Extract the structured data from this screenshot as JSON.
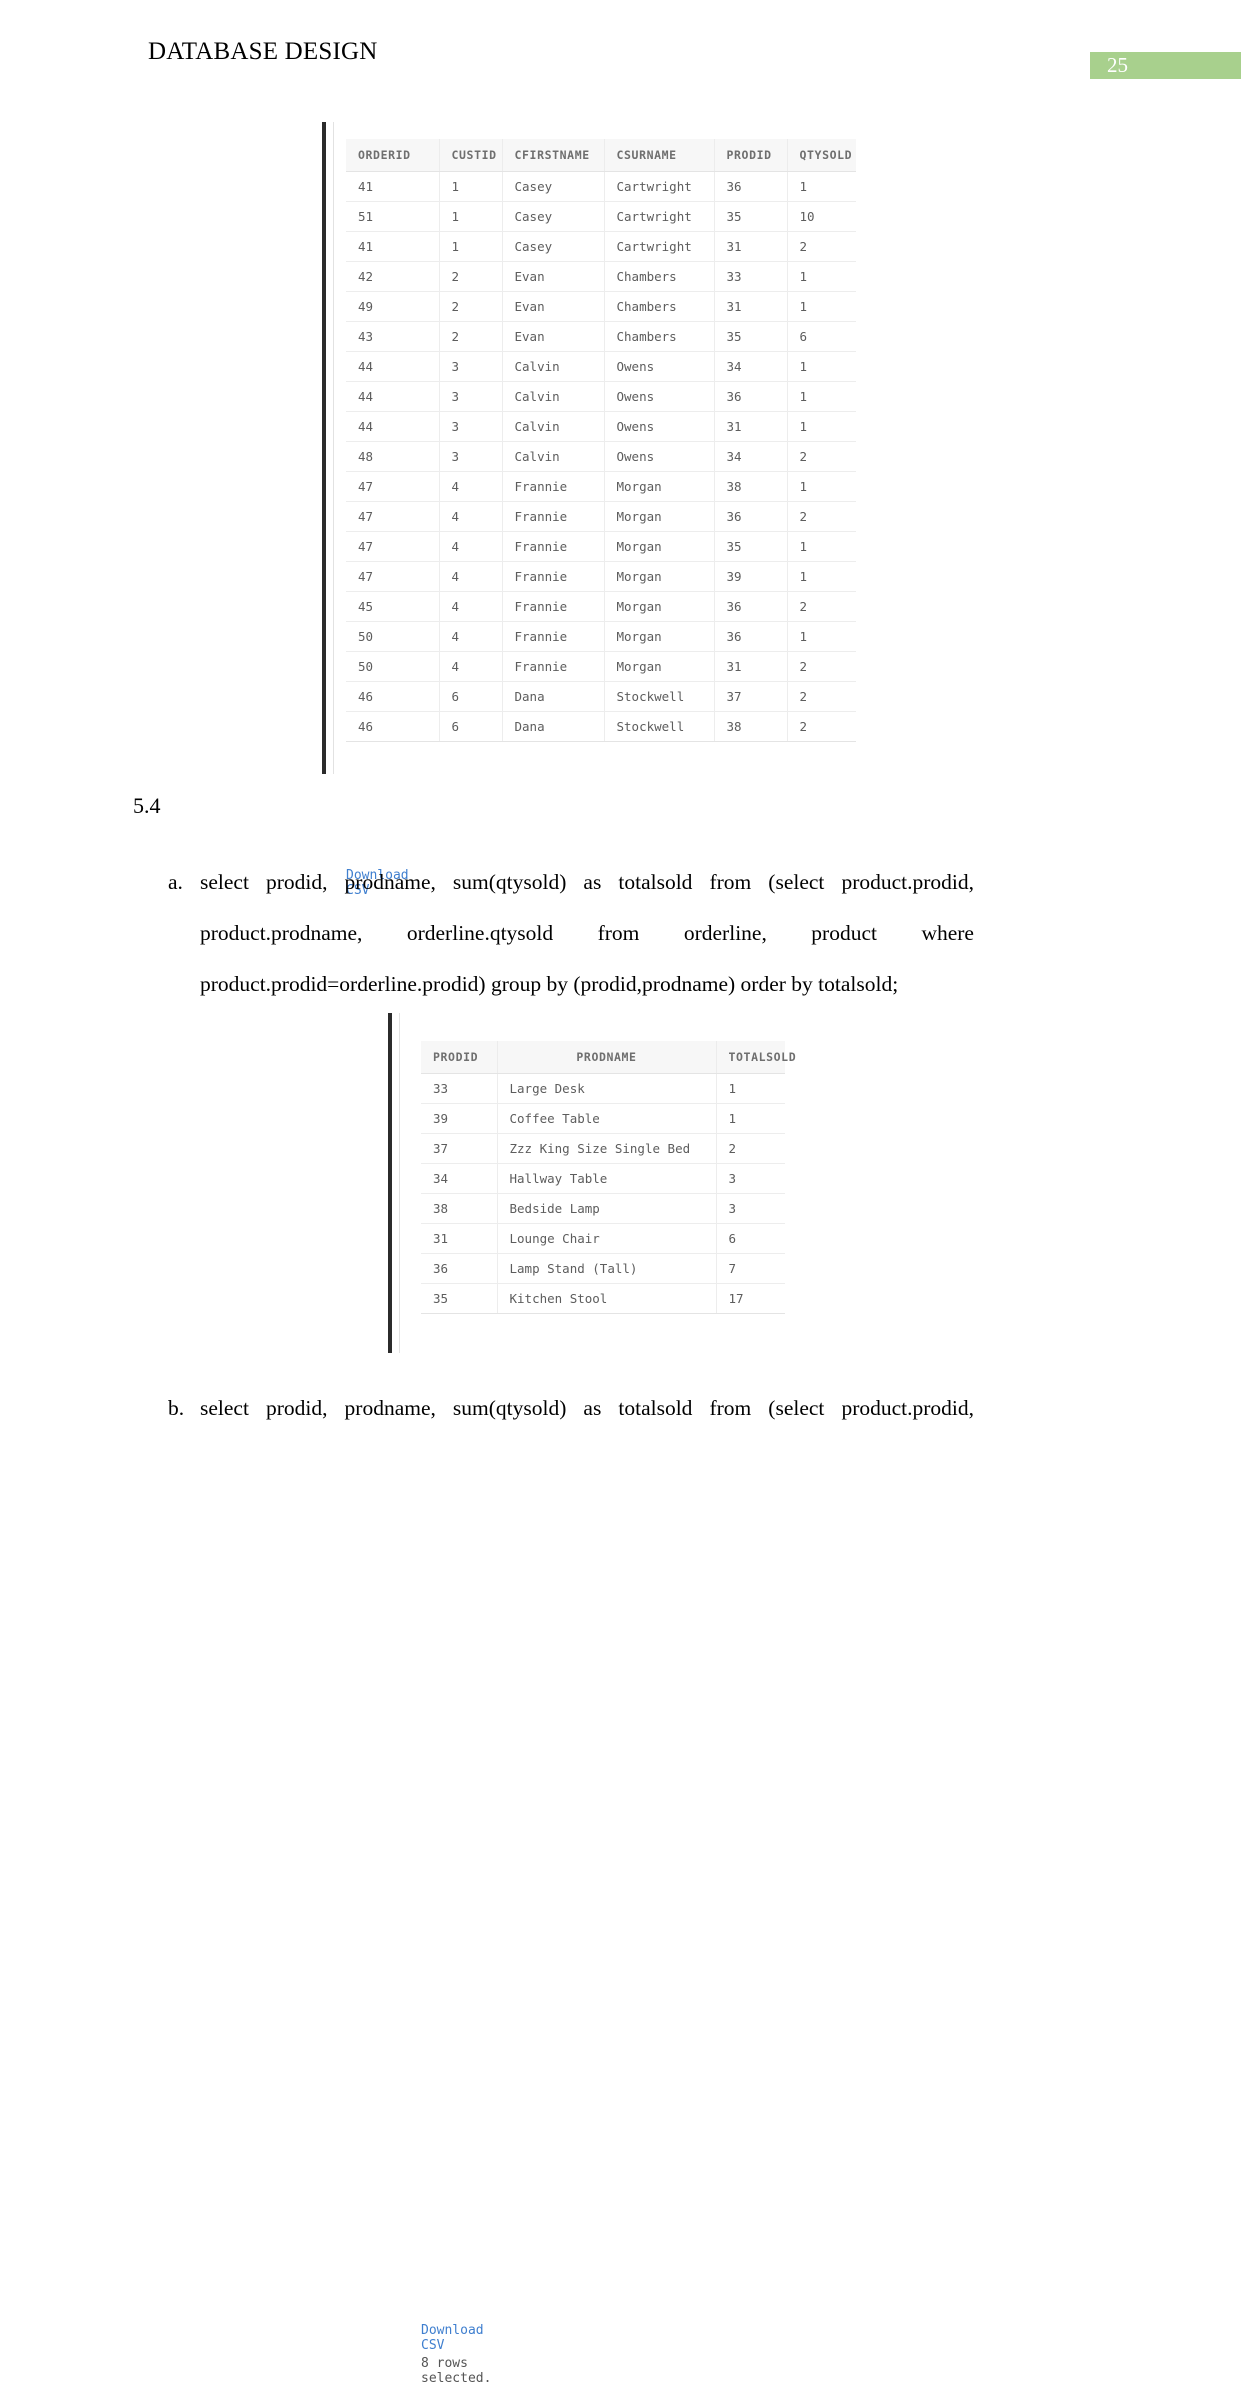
{
  "header": {
    "document_title": "DATABASE DESIGN",
    "page_number": "25",
    "badge_color": "#a8d08d"
  },
  "section": {
    "number": "5.4"
  },
  "orderline_result": {
    "columns": [
      "ORDERID",
      "CUSTID",
      "CFIRSTNAME",
      "CSURNAME",
      "PRODID",
      "QTYSOLD"
    ],
    "rows": [
      [
        "41",
        "1",
        "Casey",
        "Cartwright",
        "36",
        "1"
      ],
      [
        "51",
        "1",
        "Casey",
        "Cartwright",
        "35",
        "10"
      ],
      [
        "41",
        "1",
        "Casey",
        "Cartwright",
        "31",
        "2"
      ],
      [
        "42",
        "2",
        "Evan",
        "Chambers",
        "33",
        "1"
      ],
      [
        "49",
        "2",
        "Evan",
        "Chambers",
        "31",
        "1"
      ],
      [
        "43",
        "2",
        "Evan",
        "Chambers",
        "35",
        "6"
      ],
      [
        "44",
        "3",
        "Calvin",
        "Owens",
        "34",
        "1"
      ],
      [
        "44",
        "3",
        "Calvin",
        "Owens",
        "36",
        "1"
      ],
      [
        "44",
        "3",
        "Calvin",
        "Owens",
        "31",
        "1"
      ],
      [
        "48",
        "3",
        "Calvin",
        "Owens",
        "34",
        "2"
      ],
      [
        "47",
        "4",
        "Frannie",
        "Morgan",
        "38",
        "1"
      ],
      [
        "47",
        "4",
        "Frannie",
        "Morgan",
        "36",
        "2"
      ],
      [
        "47",
        "4",
        "Frannie",
        "Morgan",
        "35",
        "1"
      ],
      [
        "47",
        "4",
        "Frannie",
        "Morgan",
        "39",
        "1"
      ],
      [
        "45",
        "4",
        "Frannie",
        "Morgan",
        "36",
        "2"
      ],
      [
        "50",
        "4",
        "Frannie",
        "Morgan",
        "36",
        "1"
      ],
      [
        "50",
        "4",
        "Frannie",
        "Morgan",
        "31",
        "2"
      ],
      [
        "46",
        "6",
        "Dana",
        "Stockwell",
        "37",
        "2"
      ],
      [
        "46",
        "6",
        "Dana",
        "Stockwell",
        "38",
        "2"
      ]
    ],
    "download_label": "Download CSV"
  },
  "query_a": {
    "marker": "a.",
    "line1_words": [
      "select",
      "prodid,",
      "prodname,",
      "sum(qtysold)",
      "as",
      "totalsold",
      "from",
      "(select",
      "product.prodid,"
    ],
    "line2_words": [
      "product.prodname,",
      "orderline.qtysold",
      "from",
      "orderline,",
      "product",
      "where"
    ],
    "line3": "product.prodid=orderline.prodid) group by (prodid,prodname) order by totalsold;"
  },
  "product_result": {
    "columns": [
      "PRODID",
      "PRODNAME",
      "TOTALSOLD"
    ],
    "rows": [
      [
        "33",
        "Large Desk",
        "1"
      ],
      [
        "39",
        "Coffee Table",
        "1"
      ],
      [
        "37",
        "Zzz King Size Single Bed",
        "2"
      ],
      [
        "34",
        "Hallway Table",
        "3"
      ],
      [
        "38",
        "Bedside Lamp",
        "3"
      ],
      [
        "31",
        "Lounge Chair",
        "6"
      ],
      [
        "36",
        "Lamp Stand (Tall)",
        "7"
      ],
      [
        "35",
        "Kitchen Stool",
        "17"
      ]
    ],
    "download_label": "Download CSV",
    "rows_selected": "8 rows selected."
  },
  "query_b": {
    "marker": "b.",
    "line1_words": [
      "select",
      "prodid,",
      "prodname,",
      "sum(qtysold)",
      "as",
      "totalsold",
      "from",
      "(select",
      "product.prodid,"
    ]
  }
}
